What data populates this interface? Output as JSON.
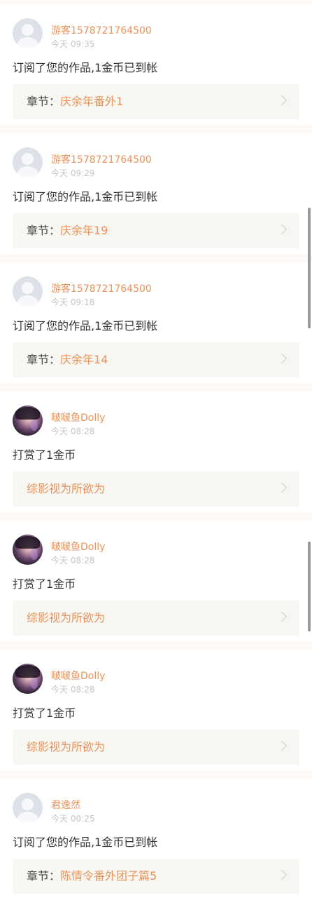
{
  "notifications": [
    {
      "avatar": "default",
      "username": "游客1578721764500",
      "time": "今天 09:35",
      "message": "订阅了您的作品,1金币已到帐",
      "chapter_prefix": "章节：",
      "chapter_title": "庆余年番外1"
    },
    {
      "avatar": "default",
      "username": "游客1578721764500",
      "time": "今天 09:29",
      "message": "订阅了您的作品,1金币已到帐",
      "chapter_prefix": "章节：",
      "chapter_title": "庆余年19"
    },
    {
      "avatar": "default",
      "username": "游客1578721764500",
      "time": "今天 09:18",
      "message": "订阅了您的作品,1金币已到帐",
      "chapter_prefix": "章节：",
      "chapter_title": "庆余年14"
    },
    {
      "avatar": "photo",
      "username": "啵啵鱼Dolly",
      "time": "今天 08:28",
      "message": "打赏了1金币",
      "chapter_prefix": "",
      "chapter_title": "综影视为所欲为"
    },
    {
      "avatar": "photo",
      "username": "啵啵鱼Dolly",
      "time": "今天 08:28",
      "message": "打赏了1金币",
      "chapter_prefix": "",
      "chapter_title": "综影视为所欲为"
    },
    {
      "avatar": "photo",
      "username": "啵啵鱼Dolly",
      "time": "今天 08:28",
      "message": "打赏了1金币",
      "chapter_prefix": "",
      "chapter_title": "综影视为所欲为"
    },
    {
      "avatar": "default",
      "username": "君逸然",
      "time": "今天 00:25",
      "message": "订阅了您的作品,1金币已到帐",
      "chapter_prefix": "章节：",
      "chapter_title": "陈情令番外团子篇5"
    }
  ],
  "colors": {
    "username": "#e8935c",
    "link_title": "#e8935c",
    "link_background": "#f7f6f0",
    "page_background": "#fcf8f6"
  },
  "icons": {
    "chevron": "chevron-right-icon",
    "default_avatar": "default-avatar-icon"
  }
}
